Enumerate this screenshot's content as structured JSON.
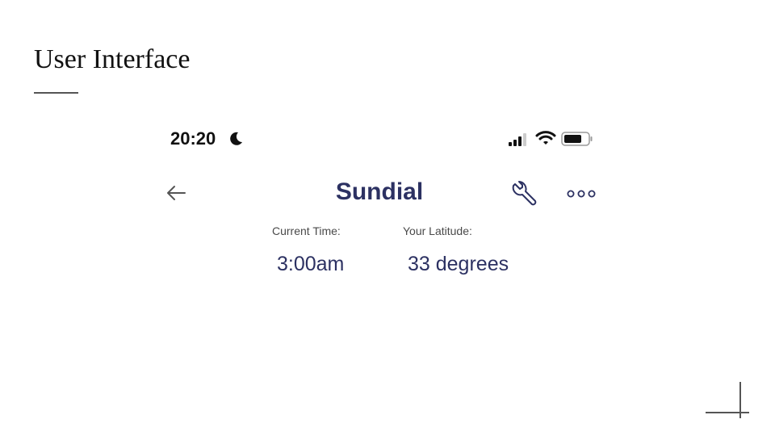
{
  "slide": {
    "title": "User Interface"
  },
  "phone": {
    "status_bar": {
      "time": "20:20",
      "icons": [
        "moon-icon",
        "signal-icon",
        "wifi-icon",
        "battery-icon"
      ]
    },
    "header": {
      "title": "Sundial",
      "back_icon": "arrow-left-icon",
      "settings_icon": "wrench-icon",
      "more_icon": "more-dots-icon"
    },
    "fields": {
      "current_time": {
        "label": "Current Time:",
        "value": "3:00am"
      },
      "latitude": {
        "label": "Your Latitude:",
        "value": "33 degrees"
      }
    }
  },
  "colors": {
    "brand_navy": "#2c3162",
    "label_gray": "#4a4a4a",
    "rule_gray": "#555555"
  }
}
